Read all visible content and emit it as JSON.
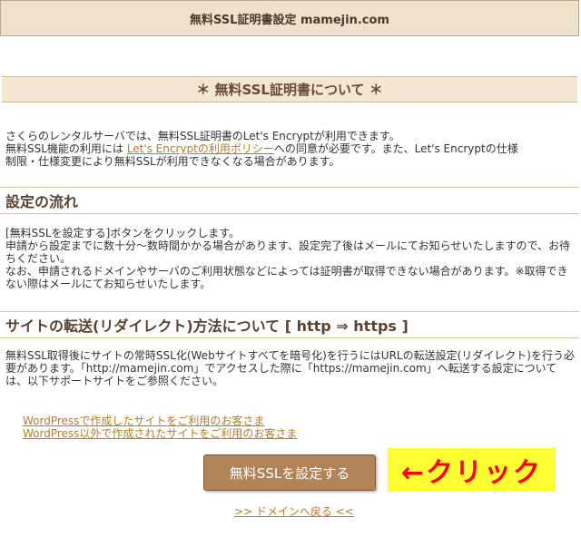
{
  "header": {
    "title": "無料SSL証明書設定 mamejin.com"
  },
  "about": {
    "title": "＊ 無料SSL証明書について ＊",
    "line1": "さくらのレンタルサーバでは、無料SSL証明書のLet's Encryptが利用できます。",
    "line2_pre": "無料SSL機能の利用には ",
    "line2_link": "Let's Encryptの利用ポリシー",
    "line2_post": "への同意が必要です。また、Let's Encryptの仕様",
    "line3": "制限・仕様変更により無料SSLが利用できなくなる場合があります。"
  },
  "flow": {
    "title": "設定の流れ",
    "line1": "[無料SSLを設定する]ボタンをクリックします。",
    "line2": "申請から設定までに数十分～数時間かかる場合があります、設定完了後はメールにてお知らせいたしますので、お待ちください。",
    "line3": "なお、申請されるドメインやサーバのご利用状態などによっては証明書が取得できない場合があります。※取得できない際はメールにてお知らせいたします。"
  },
  "redirect": {
    "title": "サイトの転送(リダイレクト)方法について [ http ⇒ https ]",
    "text": "無料SSL取得後にサイトの常時SSL化(Webサイトすべてを暗号化)を行うにはURLの転送設定(リダイレクト)を行う必要があります。「http://mamejin.com」でアクセスした際に「https://mamejin.com」へ転送する設定については、以下サポートサイトをご参照ください。"
  },
  "links": {
    "wordpress": "WordPressで作成したサイトをご利用のお客さま",
    "non_wordpress": "WordPress以外で作成されたサイトをご利用のお客さま"
  },
  "actions": {
    "set_ssl": "無料SSLを設定する",
    "annotation": "←クリック",
    "back": ">> ドメインへ戻る <<"
  }
}
